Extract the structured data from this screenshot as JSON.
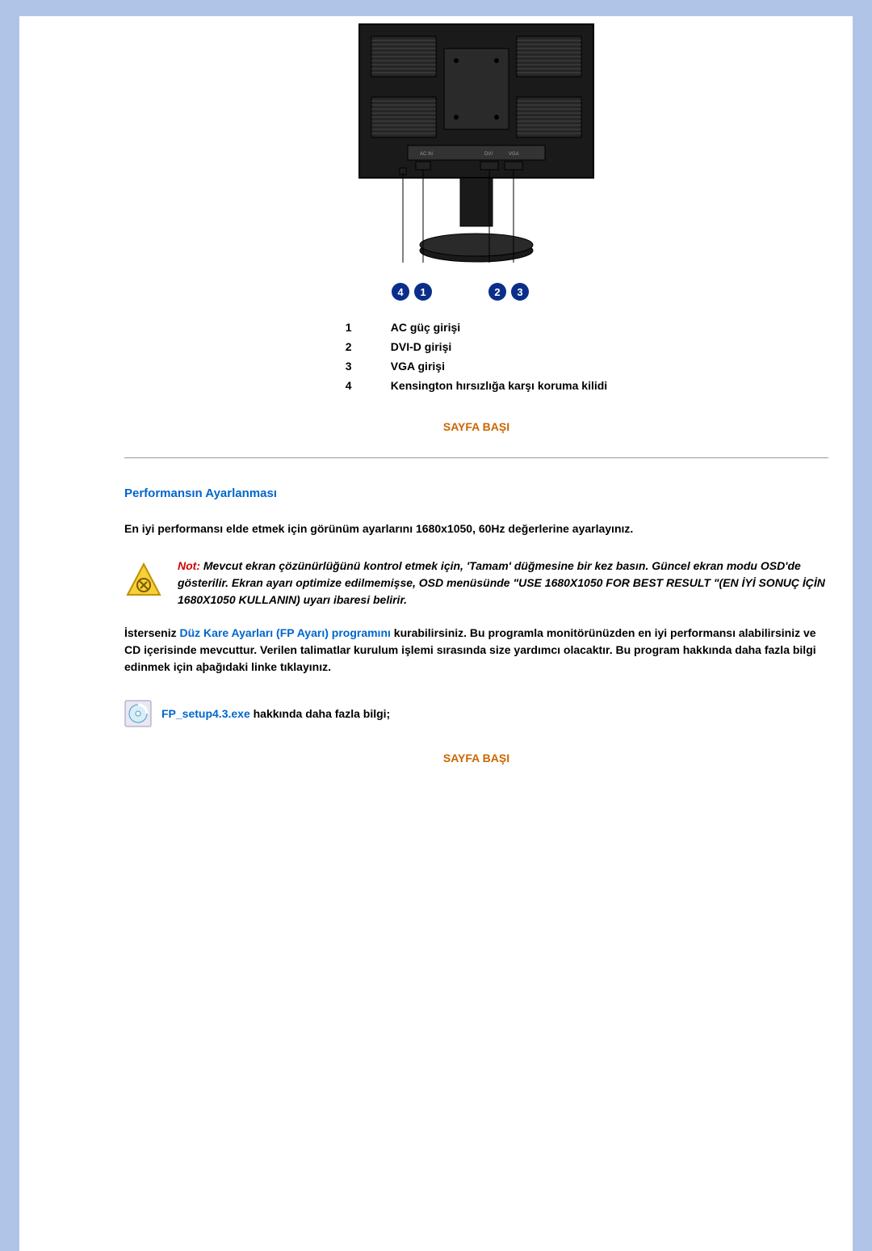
{
  "callouts_left": [
    "4",
    "1"
  ],
  "callouts_right": [
    "2",
    "3"
  ],
  "ports": [
    {
      "num": "1",
      "label": "AC güç girişi"
    },
    {
      "num": "2",
      "label": "DVI-D girişi"
    },
    {
      "num": "3",
      "label": "VGA girişi"
    },
    {
      "num": "4",
      "label": "Kensington hırsızlığa karşı koruma kilidi"
    }
  ],
  "top_link": "SAYFA BAŞI",
  "section_title": "Performansın Ayarlanması",
  "perf_text": "En iyi performansı elde etmek için görünüm ayarlarını 1680x1050, 60Hz değerlerine ayarlayınız.",
  "note_label": "Not:",
  "note_text": " Mevcut ekran çözünürlüğünü kontrol etmek için, 'Tamam' düğmesine bir kez basın. Güncel ekran modu OSD'de gösterilir. Ekran ayarı optimize edilmemişse, OSD menüsünde \"USE 1680X1050 FOR BEST RESULT \"(EN İYİ SONUÇ İÇİN 1680X1050 KULLANIN) uyarı ibaresi belirir.",
  "install_prefix": "İsterseniz ",
  "install_link": "Düz Kare Ayarları (FP Ayarı) programını",
  "install_suffix": " kurabilirsiniz. Bu programla monitörünüzden en iyi performansı alabilirsiniz ve CD içerisinde mevcuttur. Verilen talimatlar kurulum işlemi sırasında size yardımcı olacaktır. Bu program hakkında daha fazla bilgi edinmek için aþağıdaki linke tıklayınız.",
  "fp_link": "FP_setup4.3.exe",
  "fp_suffix": " hakkında daha fazla bilgi;"
}
